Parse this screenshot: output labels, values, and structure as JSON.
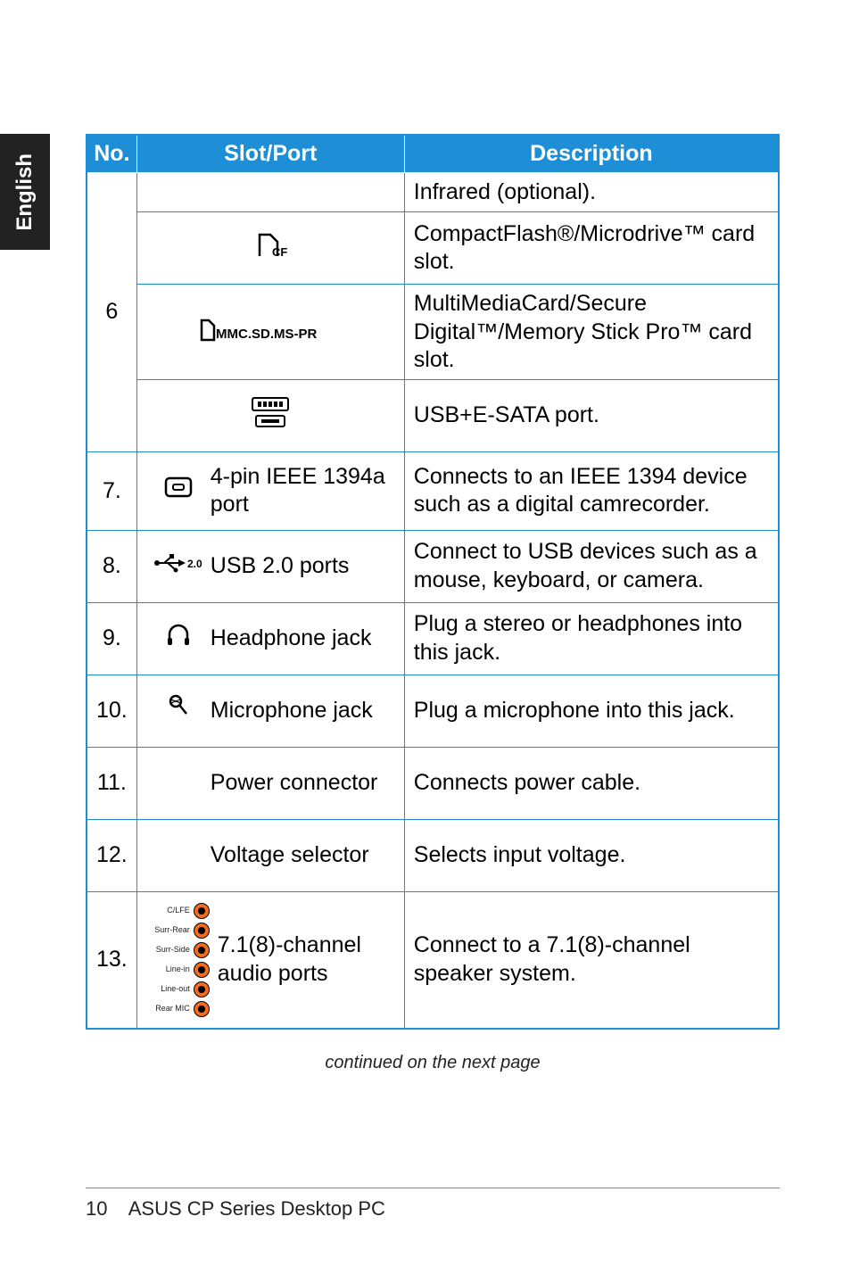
{
  "side_tab": "English",
  "headers": {
    "no": "No.",
    "slotport": "Slot/Port",
    "description": "Description"
  },
  "row6": {
    "num": "6",
    "r1_desc": "Infrared (optional).",
    "r2_icon": "CF",
    "r2_desc": "CompactFlash®/Microdrive™ card slot.",
    "r3_icon": "MMC.SD.MS-PR",
    "r3_desc": "MultiMediaCard/Secure Digital™/Memory Stick Pro™ card slot.",
    "r4_desc": "USB+E-SATA port."
  },
  "row7": {
    "num": "7.",
    "slot_label": "4-pin IEEE 1394a port",
    "desc": "Connects to an IEEE 1394 device such as a digital camrecorder."
  },
  "row8": {
    "num": "8.",
    "icon_text": "2.0",
    "slot_label": "USB 2.0 ports",
    "desc": "Connect to USB devices such as a mouse, keyboard, or camera."
  },
  "row9": {
    "num": "9.",
    "slot_label": "Headphone jack",
    "desc": "Plug a stereo or headphones into this jack."
  },
  "row10": {
    "num": "10.",
    "slot_label": "Microphone jack",
    "desc": "Plug a microphone into this jack."
  },
  "row11": {
    "num": "11.",
    "slot_label": "Power connector",
    "desc": "Connects power cable."
  },
  "row12": {
    "num": "12.",
    "slot_label": "Voltage selector",
    "desc": "Selects input voltage."
  },
  "row13": {
    "num": "13.",
    "slot_label": "7.1(8)-channel audio ports",
    "desc": "Connect to a 7.1(8)-channel speaker system.",
    "ports": [
      "C/LFE",
      "Surr-Rear",
      "Surr-Side",
      "Line-in",
      "Line-out",
      "Rear MIC"
    ]
  },
  "caption": "continued on the next page",
  "footer": {
    "page": "10",
    "title": "ASUS CP Series Desktop PC"
  }
}
